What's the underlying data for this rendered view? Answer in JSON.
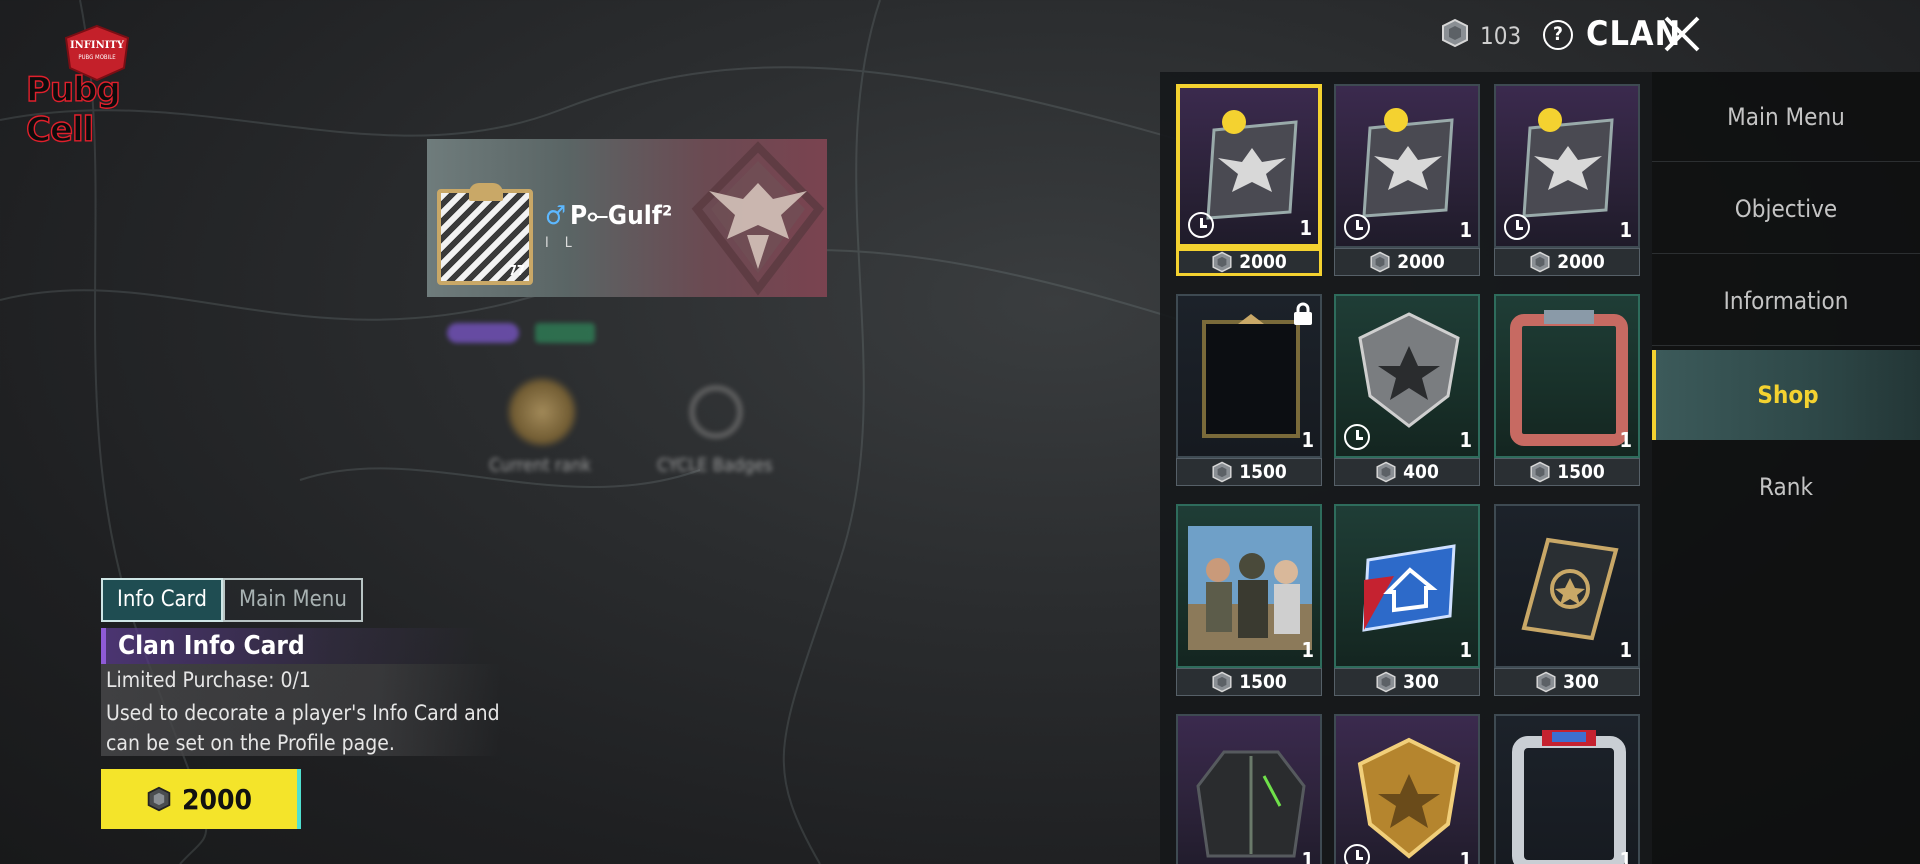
{
  "watermark": {
    "brand": "Pubg Cell",
    "top": "INFINITY",
    "sub": "PUBG MOBILE"
  },
  "topbar": {
    "currency_icon": "clan-coin-icon",
    "currency_count": "103",
    "title": "CLAN",
    "help_icon": "?"
  },
  "player_card": {
    "name": "P⟜Gulf²",
    "gender_symbol": "♂",
    "level": "77",
    "tag": "I L"
  },
  "blurred_stats": {
    "current_rank_label": "Current rank",
    "cycle_badges_label": "CYCLE Badges"
  },
  "info_tabs": [
    {
      "label": "Info Card",
      "active": true
    },
    {
      "label": "Main Menu",
      "active": false
    }
  ],
  "selected_item": {
    "title": "Clan Info Card",
    "limit": "Limited Purchase: 0/1",
    "description": "Used to decorate a player's Info Card and can be set on the Profile page.",
    "price": "2000"
  },
  "shop_items": [
    {
      "art": "emblem-card-gold-badge",
      "bg": "purple",
      "qty": "1",
      "price": "2000",
      "timer": true,
      "selected": true
    },
    {
      "art": "emblem-card-id-badge",
      "bg": "purple",
      "qty": "1",
      "price": "2000",
      "timer": true
    },
    {
      "art": "emblem-card-flag-badge",
      "bg": "purple",
      "qty": "1",
      "price": "2000",
      "timer": true
    },
    {
      "art": "dark-frame",
      "bg": "dark",
      "qty": "1",
      "price": "1500",
      "locked": true
    },
    {
      "art": "silver-shield",
      "bg": "teal",
      "qty": "1",
      "price": "400",
      "timer": true
    },
    {
      "art": "red-frame",
      "bg": "teal",
      "qty": "1",
      "price": "1500"
    },
    {
      "art": "squad-picture",
      "bg": "teal",
      "qty": "1",
      "price": "1500"
    },
    {
      "art": "house-card",
      "bg": "teal",
      "qty": "1",
      "price": "300"
    },
    {
      "art": "rename-card",
      "bg": "dark",
      "qty": "1",
      "price": "300"
    },
    {
      "art": "jacket",
      "bg": "purple",
      "qty": "1",
      "price": ""
    },
    {
      "art": "gold-shield",
      "bg": "purple",
      "qty": "1",
      "price": "",
      "timer": true
    },
    {
      "art": "silver-frame",
      "bg": "dark",
      "qty": "1",
      "price": ""
    }
  ],
  "side_menu": [
    {
      "label": "Main Menu"
    },
    {
      "label": "Objective"
    },
    {
      "label": "Information"
    },
    {
      "label": "Shop",
      "active": true
    },
    {
      "label": "Rank"
    }
  ],
  "colors": {
    "accent_yellow": "#f4d230",
    "buy_button": "#f4e42a",
    "active_tab": "#1f4d52"
  }
}
